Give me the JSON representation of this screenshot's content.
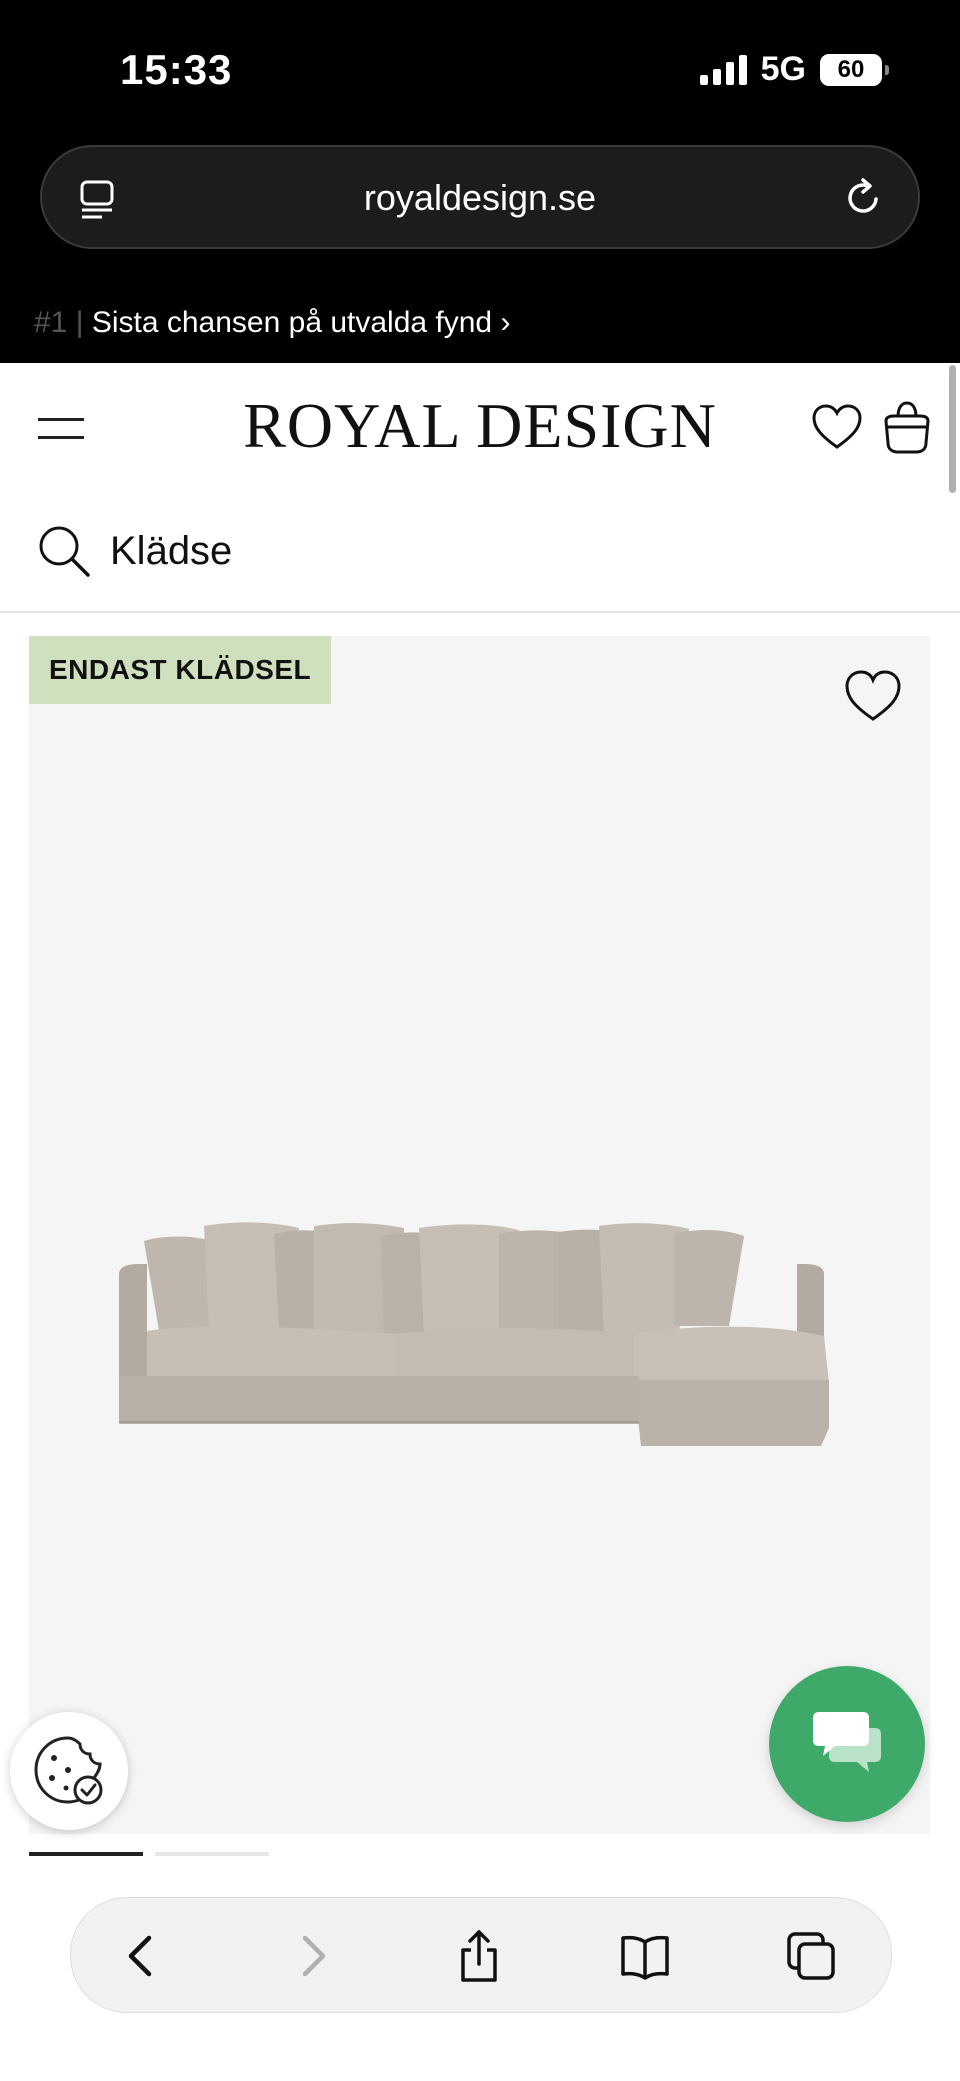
{
  "status_bar": {
    "time": "15:33",
    "network": "5G",
    "battery": "60"
  },
  "browser": {
    "url": "royaldesign.se"
  },
  "promo": {
    "prefix": "#1 | ",
    "text": "Sista chansen på utvalda fynd",
    "chevron": "›"
  },
  "header": {
    "logo": "ROYAL DESIGN"
  },
  "search": {
    "value": "Klädse"
  },
  "product": {
    "badge": "ENDAST KLÄDSEL",
    "image_alt": "sofa"
  },
  "carousel": {
    "count": 2,
    "active": 0
  },
  "colors": {
    "badge_bg": "#cfe0bf",
    "chat_bg": "#3fa96a",
    "card_bg": "#f5f5f5"
  },
  "icons": [
    "menu-icon",
    "heart-icon",
    "bag-icon",
    "search-icon",
    "reader-icon",
    "reload-icon",
    "chat-icon",
    "cookie-icon",
    "back-icon",
    "forward-icon",
    "share-icon",
    "bookmarks-icon",
    "tabs-icon"
  ]
}
